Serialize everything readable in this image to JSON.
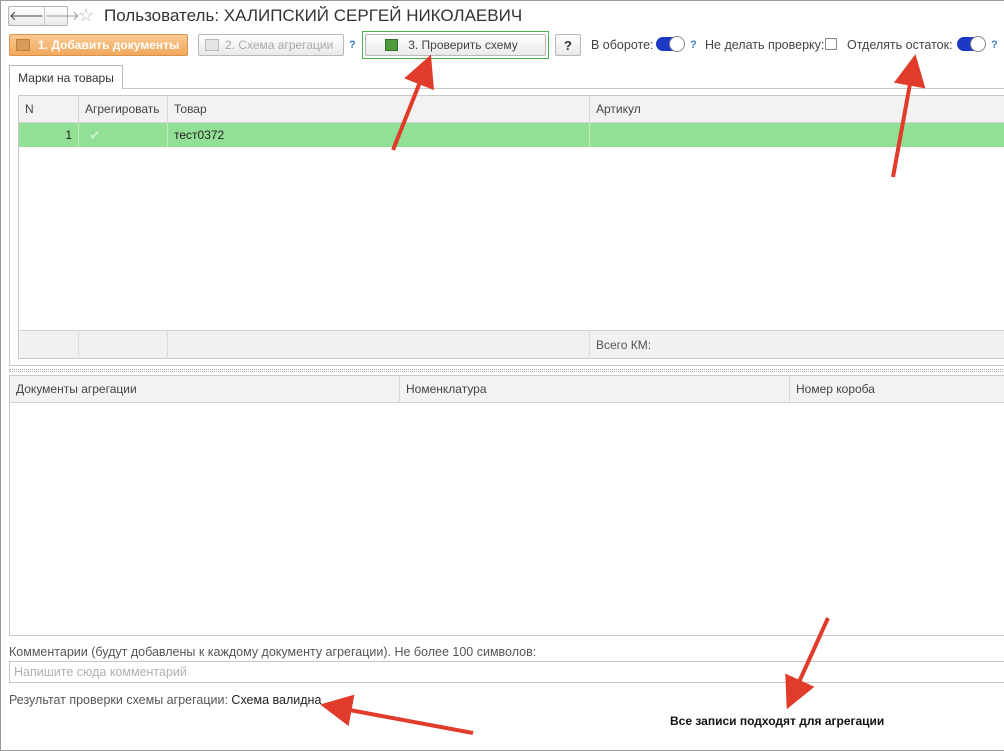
{
  "nav": {
    "back_glyph": "🡐",
    "forward_glyph": "🡒",
    "favorite_glyph": "☆"
  },
  "title": "Пользователь: ХАЛИПСКИЙ СЕРГЕЙ НИКОЛАЕВИЧ",
  "toolbar": {
    "add_documents": "1. Добавить документы",
    "aggregation_scheme": "2. Схема агрегации",
    "scheme_help": "?",
    "check_scheme": "3. Проверить схему",
    "help": "?",
    "in_circulation_label": "В обороте:",
    "in_circulation_help": "?",
    "no_check_label": "Не делать проверку:",
    "separate_rest_label": "Отделять остаток:",
    "separate_rest_help": "?"
  },
  "tab": {
    "label": "Марки на товары"
  },
  "marks_table": {
    "columns": [
      "N",
      "Агрегировать",
      "Товар",
      "Артикул"
    ],
    "rows": [
      {
        "n": "1",
        "aggregate_glyph": "✔",
        "product": "тест0372",
        "article": ""
      }
    ],
    "footer_total_label": "Всего КМ:"
  },
  "docs_table": {
    "columns": [
      "Документы  агрегации",
      "Номенклатура",
      "Номер короба"
    ]
  },
  "comments": {
    "hint": "Комментарии (будут добавлены к каждому документу агрегации). Не более 100 символов:",
    "placeholder": "Напишите сюда комментарий"
  },
  "result": {
    "label": "Результат проверки схемы агрегации:",
    "value": "Схема валидна"
  },
  "note": "Все записи подходят для агрегации",
  "colors": {
    "accent_orange": "#f1a85c",
    "selected_row_green": "#92e096",
    "toggle_blue": "#1d39c4",
    "annotation_red": "#e03b2b"
  }
}
